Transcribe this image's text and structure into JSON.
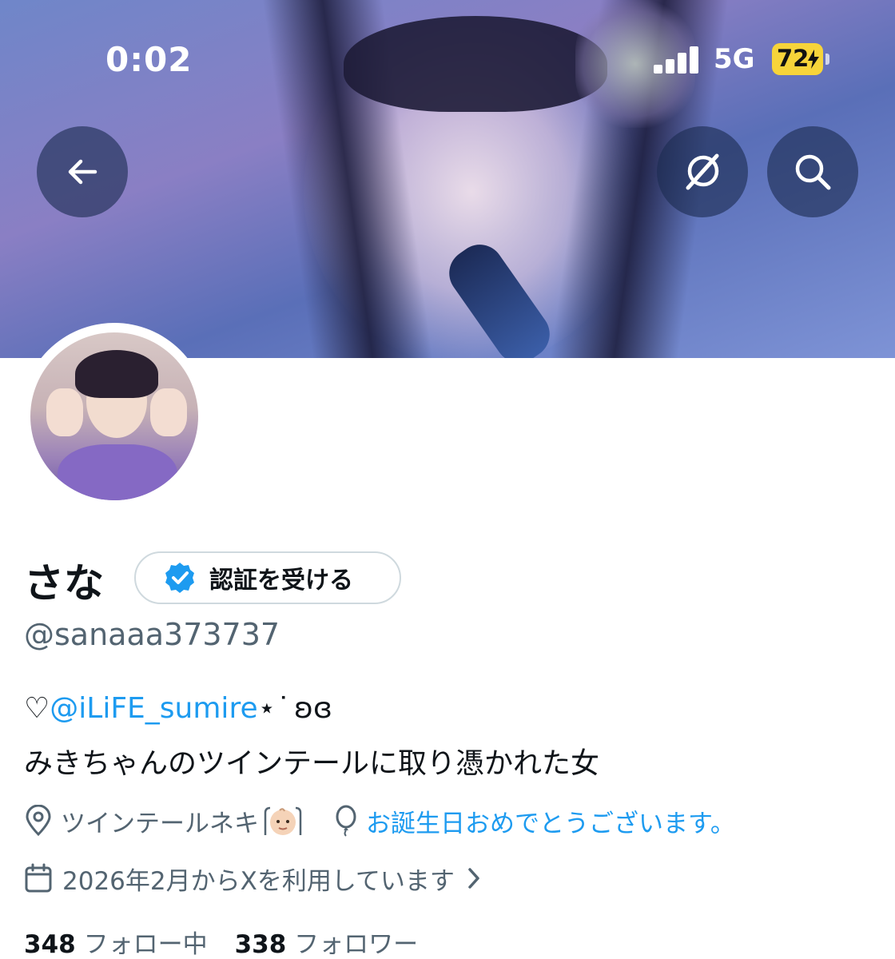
{
  "status_bar": {
    "time": "0:02",
    "network": "5G",
    "battery": "72"
  },
  "header": {
    "back_icon": "arrow-left-icon",
    "grok_icon": "grok-icon",
    "search_icon": "search-icon"
  },
  "profile": {
    "display_name": "さな",
    "verify_button_label": "認証を受ける",
    "handle": "@sanaaa373737",
    "bio_prefix": "♡",
    "bio_mention": "@iLiFE_sumire",
    "bio_suffix": "⋆ ͘ ʚɞ",
    "bio_line2": "みきちゃんのツインテールに取り憑かれた女",
    "location": "ツインテールネキ",
    "location_emoji": "baby-face",
    "birthday_text": "お誕生日おめでとうございます。",
    "joined": "2026年2月からXを利用しています",
    "following_count": "348",
    "following_label": "フォロー中",
    "followers_count": "338",
    "followers_label": "フォロワー"
  },
  "colors": {
    "accent": "#1d9bf0",
    "secondary_text": "#536471",
    "battery": "#f7d43a"
  }
}
